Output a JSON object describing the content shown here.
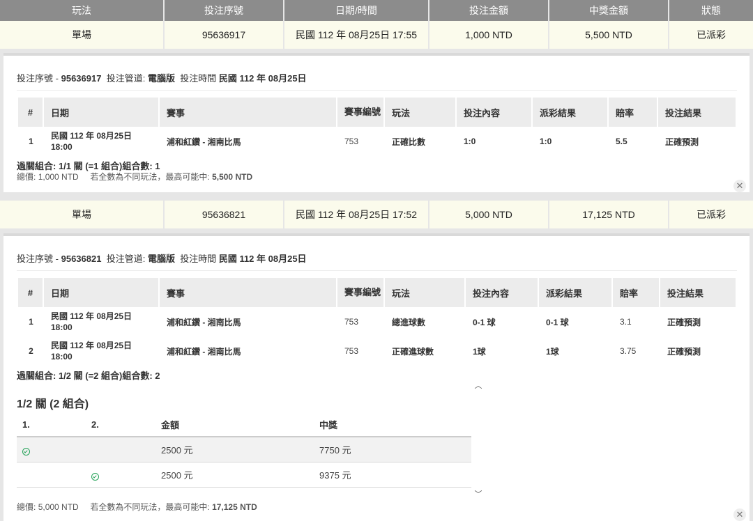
{
  "header": [
    "玩法",
    "投注序號",
    "日期/時間",
    "投注金額",
    "中獎金額",
    "狀態"
  ],
  "bets": [
    {
      "summary": {
        "play": "單場",
        "serial": "95636917",
        "datetime": "民國 112 年 08月25日 17:55",
        "amount": "1,000 NTD",
        "win": "5,500 NTD",
        "status": "已派彩"
      },
      "detail": {
        "serial_label": "投注序號",
        "serial_dash": "-",
        "serial": "95636917",
        "channel_label": "投注管道:",
        "channel": "電腦版",
        "time_label": "投注時間",
        "time": "民國 112 年 08月25日",
        "columns": [
          "#",
          "日期",
          "賽事",
          "賽事編號",
          "玩法",
          "投注內容",
          "派彩結果",
          "賠率",
          "投注結果"
        ],
        "rows": [
          {
            "n": "1",
            "date": "民國 112 年 08月25日",
            "time": "18:00",
            "match": "浦和紅鑽 - 湘南比馬",
            "id": "753",
            "play": "正確比數",
            "content": "1:0",
            "result": "1:0",
            "odds": "5.5",
            "outcome": "正確預測"
          }
        ],
        "combo_line": "過關組合: 1/1 關 (=1 組合)組合數: 1",
        "total_label": "總價:",
        "total": "1,000 NTD",
        "max_label": "若全數為不同玩法，最高可能中:",
        "max": "5,500 NTD"
      }
    },
    {
      "summary": {
        "play": "單場",
        "serial": "95636821",
        "datetime": "民國 112 年 08月25日 17:52",
        "amount": "5,000 NTD",
        "win": "17,125 NTD",
        "status": "已派彩"
      },
      "detail": {
        "serial_label": "投注序號",
        "serial_dash": "-",
        "serial": "95636821",
        "channel_label": "投注管道:",
        "channel": "電腦版",
        "time_label": "投注時間",
        "time": "民國 112 年 08月25日",
        "columns": [
          "#",
          "日期",
          "賽事",
          "賽事編號",
          "玩法",
          "投注內容",
          "派彩結果",
          "賠率",
          "投注結果"
        ],
        "rows": [
          {
            "n": "1",
            "date": "民國 112 年 08月25日",
            "time": "18:00",
            "match": "浦和紅鑽 - 湘南比馬",
            "id": "753",
            "play": "總進球數",
            "content": "0-1 球",
            "result": "0-1 球",
            "odds": "3.1",
            "outcome": "正確預測"
          },
          {
            "n": "2",
            "date": "民國 112 年 08月25日",
            "time": "18:00",
            "match": "浦和紅鑽 - 湘南比馬",
            "id": "753",
            "play": "正確進球數",
            "content": "1球",
            "result": "1球",
            "odds": "3.75",
            "outcome": "正確預測"
          }
        ],
        "combo_line": "過關組合: 1/2 關 (=2 組合)組合數: 2",
        "combo_title": "1/2 關 (2 組合)",
        "combo_cols": [
          "1.",
          "2.",
          "金額",
          "中獎"
        ],
        "combo_rows": [
          {
            "leg1": true,
            "leg2": false,
            "amount": "2500 元",
            "win": "7750 元"
          },
          {
            "leg1": false,
            "leg2": true,
            "amount": "2500 元",
            "win": "9375 元"
          }
        ],
        "total_label": "總價:",
        "total": "5,000 NTD",
        "max_label": "若全數為不同玩法，最高可能中:",
        "max": "17,125 NTD"
      }
    }
  ],
  "icons": {
    "close": "close-icon",
    "check": "check-circle-icon",
    "up": "chevron-up-icon",
    "down": "chevron-down-icon"
  }
}
